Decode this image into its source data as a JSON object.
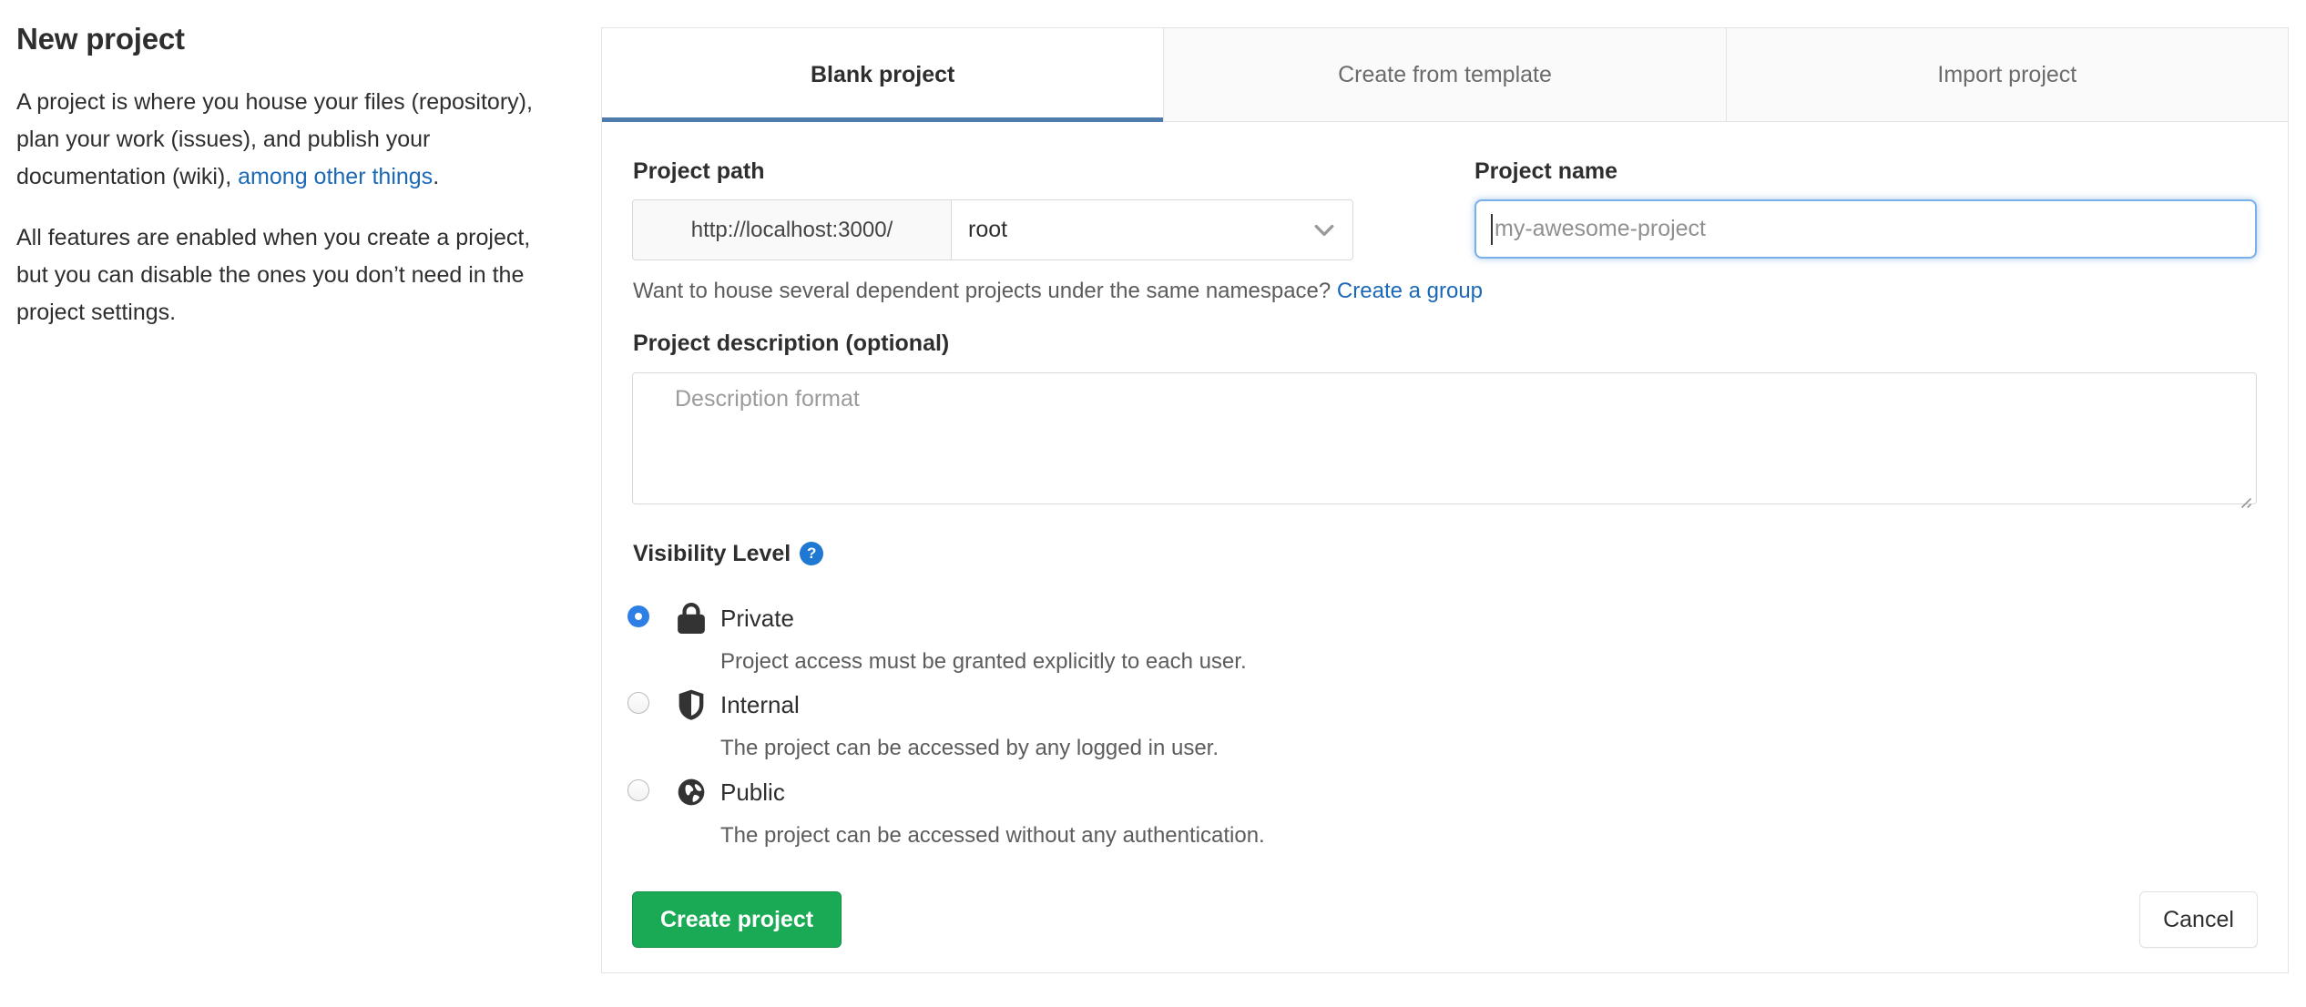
{
  "colors": {
    "link": "#1b69b6",
    "tab_underline": "#4d7bab",
    "radio": "#2e7fe5",
    "help": "#1f78d1",
    "green": "#1aaa55"
  },
  "sidebar": {
    "title": "New project",
    "p1_before": "A project is where you house your files (repository), plan your work (issues), and publish your documentation (wiki), ",
    "p1_link": "among other things",
    "p1_after": ".",
    "p2": "All features are enabled when you create a project, but you can disable the ones you don’t need in the project settings."
  },
  "tabs": [
    {
      "label": "Blank project",
      "active": true
    },
    {
      "label": "Create from template",
      "active": false
    },
    {
      "label": "Import project",
      "active": false
    }
  ],
  "form": {
    "project_path": {
      "label": "Project path",
      "url_prefix": "http://localhost:3000/",
      "namespace": "root"
    },
    "project_name": {
      "label": "Project name",
      "placeholder": "my-awesome-project"
    },
    "namespace_hint": {
      "text": "Want to house several dependent projects under the same namespace? ",
      "link": "Create a group"
    },
    "description": {
      "label": "Project description (optional)",
      "placeholder": "Description format"
    },
    "visibility": {
      "label": "Visibility Level",
      "help_glyph": "?",
      "options": [
        {
          "name": "Private",
          "icon": "lock-icon",
          "selected": true,
          "description": "Project access must be granted explicitly to each user."
        },
        {
          "name": "Internal",
          "icon": "shield-icon",
          "selected": false,
          "description": "The project can be accessed by any logged in user."
        },
        {
          "name": "Public",
          "icon": "globe-icon",
          "selected": false,
          "description": "The project can be accessed without any authentication."
        }
      ]
    },
    "submit_label": "Create project",
    "cancel_label": "Cancel"
  }
}
